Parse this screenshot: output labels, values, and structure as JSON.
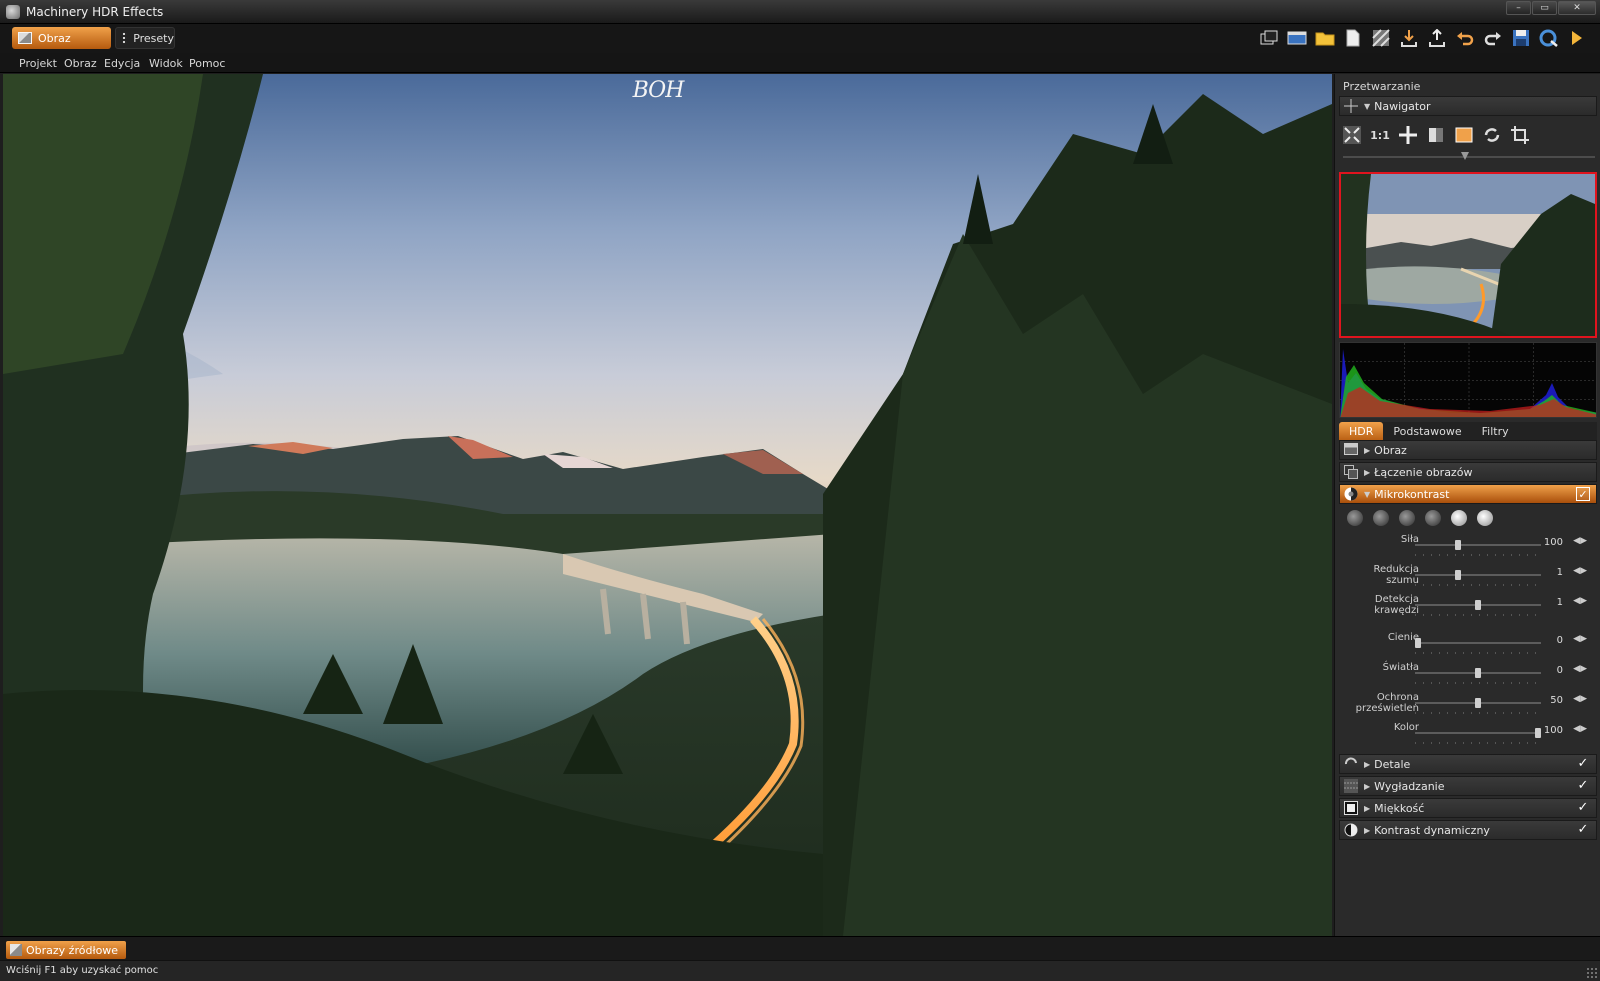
{
  "window": {
    "title": "Machinery HDR Effects"
  },
  "toolbar": {
    "modes": [
      {
        "label": "Obraz",
        "active": true
      },
      {
        "label": "Presety",
        "active": false
      }
    ],
    "icons": [
      "windows-icon",
      "window-icon",
      "folder-open-icon",
      "new-file-icon",
      "batch-icon",
      "import-icon",
      "export-icon",
      "undo-icon",
      "redo-icon",
      "save-icon",
      "process-icon",
      "play-icon"
    ]
  },
  "menu": {
    "items": [
      "Projekt",
      "Obraz",
      "Edycja",
      "Widok",
      "Pomoc"
    ]
  },
  "image": {
    "watermark": "BOH"
  },
  "panel": {
    "title": "Przetwarzanie",
    "navigator": {
      "label": "Nawigator",
      "tools": [
        "fit-icon",
        "1:1",
        "pan-icon",
        "compare-icon",
        "frame-icon",
        "rotate-icon",
        "crop-icon"
      ]
    },
    "tabs": [
      {
        "label": "HDR",
        "active": true
      },
      {
        "label": "Podstawowe",
        "active": false
      },
      {
        "label": "Filtry",
        "active": false
      }
    ],
    "sections_top": [
      {
        "label": "Obraz",
        "expanded": false,
        "icon": "image-icon"
      },
      {
        "label": "Łączenie obrazów",
        "expanded": false,
        "icon": "merge-icon"
      }
    ],
    "mikrokontrast": {
      "label": "Mikrokontrast",
      "checked": true,
      "presets_count": 6,
      "sliders": [
        {
          "label": "Siła",
          "label2": "",
          "value": "100",
          "fraction": 0.33
        },
        {
          "label": "Redukcja",
          "label2": "szumu",
          "value": "1",
          "fraction": 0.33
        },
        {
          "label": "Detekcja",
          "label2": "krawędzi",
          "value": "1",
          "fraction": 0.5
        },
        {
          "label": "Cienie",
          "label2": "",
          "value": "0",
          "fraction": 0.0
        },
        {
          "label": "Światła",
          "label2": "",
          "value": "0",
          "fraction": 0.5
        },
        {
          "label": "Ochrona",
          "label2": "prześwietleń",
          "value": "50",
          "fraction": 0.5
        },
        {
          "label": "Kolor",
          "label2": "",
          "value": "100",
          "fraction": 1.0
        }
      ]
    },
    "sections_bottom": [
      {
        "label": "Detale",
        "checked": true,
        "icon": "detail-icon"
      },
      {
        "label": "Wygładzanie",
        "checked": true,
        "icon": "smooth-icon"
      },
      {
        "label": "Miękkość",
        "checked": true,
        "icon": "soft-icon"
      },
      {
        "label": "Kontrast dynamiczny",
        "checked": true,
        "icon": "dynamic-contrast-icon"
      }
    ]
  },
  "bottom": {
    "source_tab": "Obrazy źródłowe"
  },
  "status": {
    "text": "Wciśnij F1 aby uzyskać pomoc"
  },
  "colors": {
    "accent": "#e0861f",
    "panel": "#2a2a2a",
    "highlight_border": "#e0141e"
  }
}
